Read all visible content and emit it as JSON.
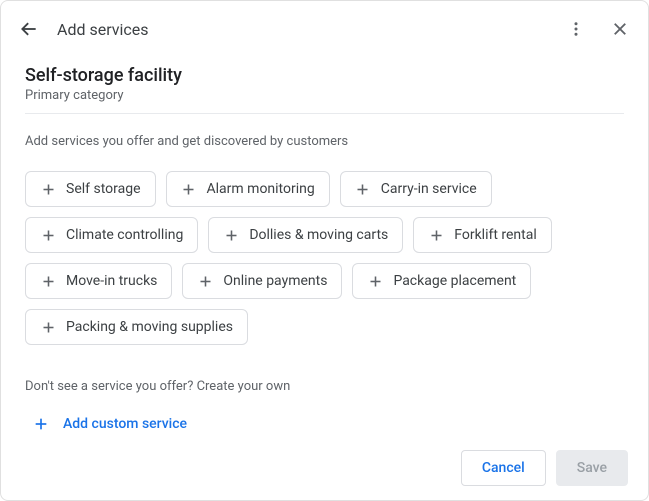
{
  "header": {
    "title": "Add services"
  },
  "category": {
    "title": "Self-storage facility",
    "subtitle": "Primary category"
  },
  "instruction": "Add services you offer and get discovered by customers",
  "services": [
    "Self storage",
    "Alarm monitoring",
    "Carry-in service",
    "Climate controlling",
    "Dollies & moving carts",
    "Forklift rental",
    "Move-in trucks",
    "Online payments",
    "Package placement",
    "Packing & moving supplies"
  ],
  "custom": {
    "prompt": "Don't see a service you offer? Create your own",
    "button": "Add custom service"
  },
  "footer": {
    "cancel": "Cancel",
    "save": "Save"
  }
}
